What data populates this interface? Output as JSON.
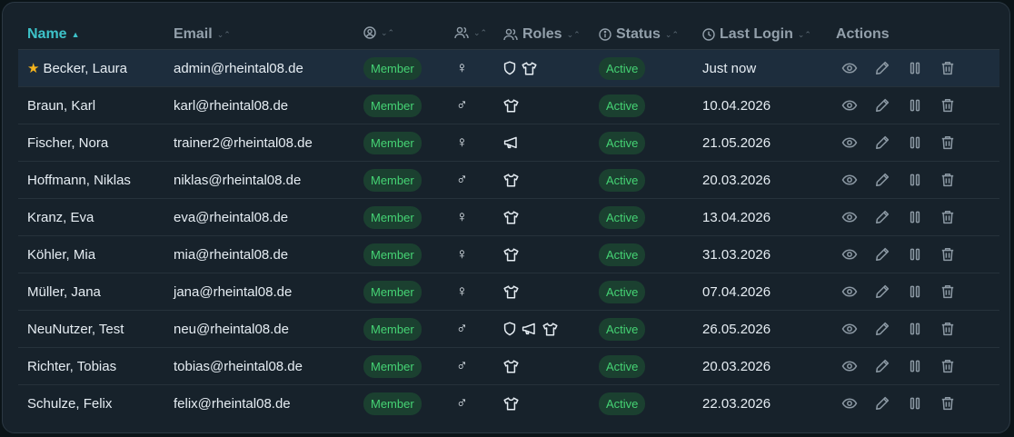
{
  "table": {
    "headers": {
      "name": "Name",
      "name_sort": "▲",
      "email": "Email",
      "roles": "Roles",
      "status": "Status",
      "last_login": "Last Login",
      "actions": "Actions",
      "sort_indicator": "⌄⌃"
    },
    "rows": [
      {
        "name": "Becker, Laura",
        "email": "admin@rheintal08.de",
        "type": "Member",
        "gender": "♀",
        "roles": [
          "shield-icon",
          "shirt-icon"
        ],
        "status": "Active",
        "last_login": "Just now",
        "starred": true
      },
      {
        "name": "Braun, Karl",
        "email": "karl@rheintal08.de",
        "type": "Member",
        "gender": "♂",
        "roles": [
          "shirt-icon"
        ],
        "status": "Active",
        "last_login": "10.04.2026"
      },
      {
        "name": "Fischer, Nora",
        "email": "trainer2@rheintal08.de",
        "type": "Member",
        "gender": "♀",
        "roles": [
          "megaphone-icon"
        ],
        "status": "Active",
        "last_login": "21.05.2026"
      },
      {
        "name": "Hoffmann, Niklas",
        "email": "niklas@rheintal08.de",
        "type": "Member",
        "gender": "♂",
        "roles": [
          "shirt-icon"
        ],
        "status": "Active",
        "last_login": "20.03.2026"
      },
      {
        "name": "Kranz, Eva",
        "email": "eva@rheintal08.de",
        "type": "Member",
        "gender": "♀",
        "roles": [
          "shirt-icon"
        ],
        "status": "Active",
        "last_login": "13.04.2026"
      },
      {
        "name": "Köhler, Mia",
        "email": "mia@rheintal08.de",
        "type": "Member",
        "gender": "♀",
        "roles": [
          "shirt-icon"
        ],
        "status": "Active",
        "last_login": "31.03.2026"
      },
      {
        "name": "Müller, Jana",
        "email": "jana@rheintal08.de",
        "type": "Member",
        "gender": "♀",
        "roles": [
          "shirt-icon"
        ],
        "status": "Active",
        "last_login": "07.04.2026"
      },
      {
        "name": "NeuNutzer, Test",
        "email": "neu@rheintal08.de",
        "type": "Member",
        "gender": "♂",
        "roles": [
          "shield-icon",
          "megaphone-icon",
          "shirt-icon"
        ],
        "status": "Active",
        "last_login": "26.05.2026"
      },
      {
        "name": "Richter, Tobias",
        "email": "tobias@rheintal08.de",
        "type": "Member",
        "gender": "♂",
        "roles": [
          "shirt-icon"
        ],
        "status": "Active",
        "last_login": "20.03.2026"
      },
      {
        "name": "Schulze, Felix",
        "email": "felix@rheintal08.de",
        "type": "Member",
        "gender": "♂",
        "roles": [
          "shirt-icon"
        ],
        "status": "Active",
        "last_login": "22.03.2026"
      }
    ]
  },
  "colors": {
    "accent": "#3dc2c9",
    "badge_bg": "#1b4030",
    "badge_text": "#45d374",
    "star": "#f5b41d"
  }
}
